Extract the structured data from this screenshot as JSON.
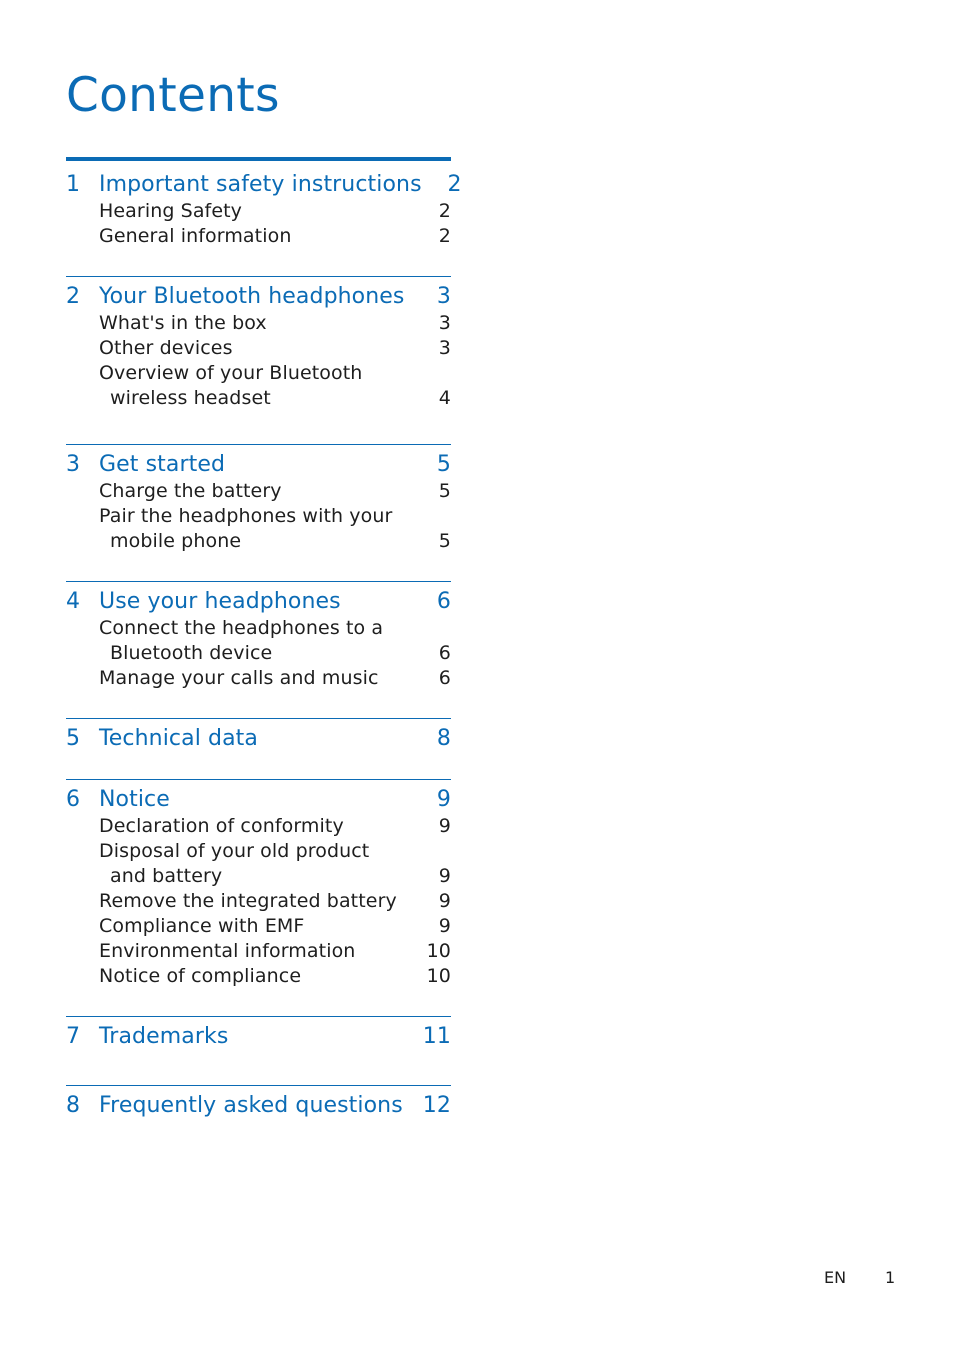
{
  "page_title": "Contents",
  "colors": {
    "accent": "#0b6bb5",
    "text": "#1e1e1e"
  },
  "sections": [
    {
      "number": "1",
      "title": "Important safety instructions",
      "page": "2",
      "items": [
        {
          "lines": [
            "Hearing Safety"
          ],
          "page": "2"
        },
        {
          "lines": [
            "General information"
          ],
          "page": "2"
        }
      ]
    },
    {
      "number": "2",
      "title": "Your Bluetooth headphones",
      "page": "3",
      "items": [
        {
          "lines": [
            "What's in the box"
          ],
          "page": "3"
        },
        {
          "lines": [
            "Other devices"
          ],
          "page": "3"
        },
        {
          "lines": [
            "Overview of your Bluetooth",
            "wireless headset"
          ],
          "page": "4"
        }
      ]
    },
    {
      "number": "3",
      "title": "Get started",
      "page": "5",
      "items": [
        {
          "lines": [
            "Charge the battery"
          ],
          "page": "5"
        },
        {
          "lines": [
            "Pair the headphones with your",
            "mobile phone"
          ],
          "page": "5"
        }
      ]
    },
    {
      "number": "4",
      "title": "Use your headphones",
      "page": "6",
      "items": [
        {
          "lines": [
            "Connect the headphones to a",
            "Bluetooth device"
          ],
          "page": "6"
        },
        {
          "lines": [
            "Manage your calls and music"
          ],
          "page": "6"
        }
      ]
    },
    {
      "number": "5",
      "title": "Technical data",
      "page": "8",
      "items": []
    },
    {
      "number": "6",
      "title": "Notice",
      "page": "9",
      "items": [
        {
          "lines": [
            "Declaration of conformity"
          ],
          "page": "9"
        },
        {
          "lines": [
            "Disposal of your old product",
            "and battery"
          ],
          "page": "9"
        },
        {
          "lines": [
            "Remove the integrated battery"
          ],
          "page": "9"
        },
        {
          "lines": [
            "Compliance with EMF"
          ],
          "page": "9"
        },
        {
          "lines": [
            "Environmental information"
          ],
          "page": "10"
        },
        {
          "lines": [
            "Notice of compliance"
          ],
          "page": "10"
        }
      ]
    },
    {
      "number": "7",
      "title": "Trademarks",
      "page": "11",
      "items": []
    },
    {
      "number": "8",
      "title": "Frequently asked questions",
      "page": "12",
      "items": []
    }
  ],
  "footer": {
    "language": "EN",
    "page_number": "1"
  }
}
